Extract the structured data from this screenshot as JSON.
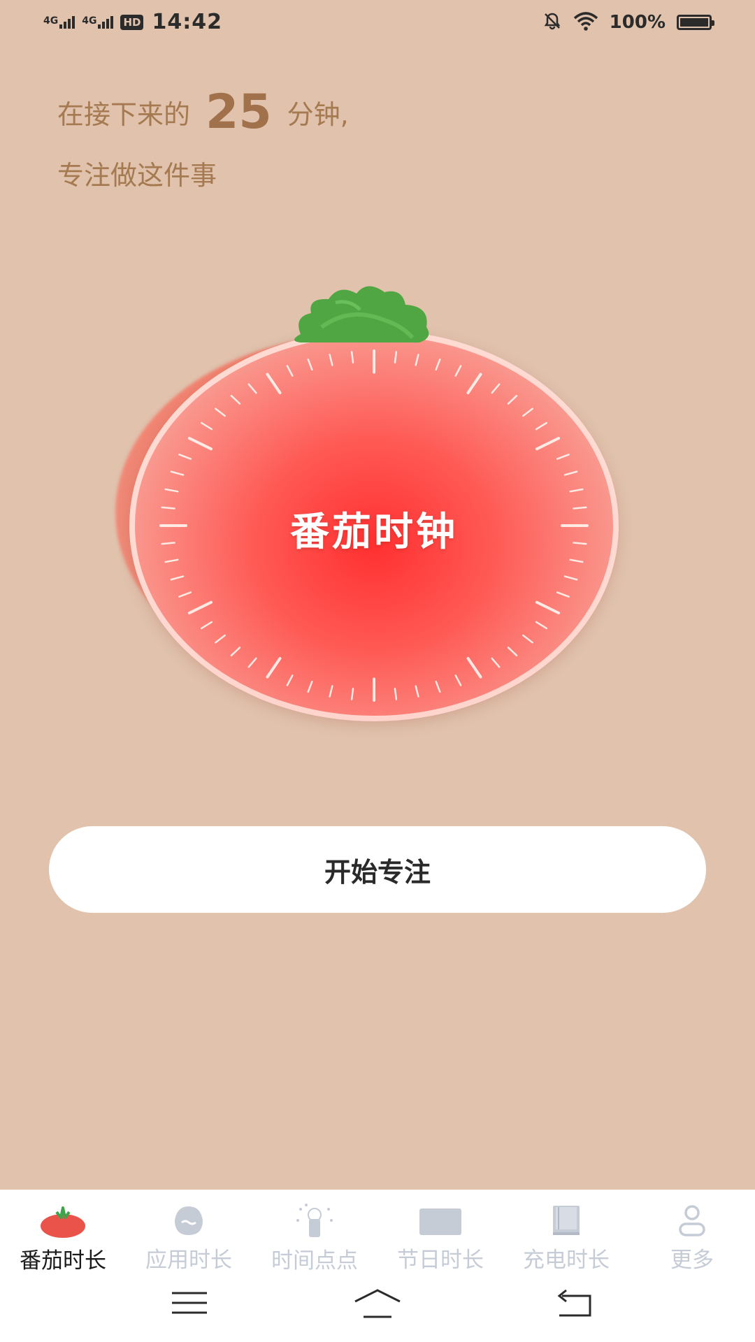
{
  "status_bar": {
    "network1": "4G",
    "network2": "4G",
    "hd": "HD",
    "time": "14:42",
    "battery": "100%"
  },
  "headline": {
    "prefix": "在接下来的",
    "minutes": "25",
    "suffix": "分钟,",
    "line2": "专注做这件事"
  },
  "tomato": {
    "title": "番茄时钟"
  },
  "start_button": {
    "label": "开始专注"
  },
  "bottom_nav": {
    "items": [
      {
        "label": "番茄时长",
        "icon": "tomato-icon",
        "active": true
      },
      {
        "label": "应用时长",
        "icon": "app-time-icon",
        "active": false
      },
      {
        "label": "时间点点",
        "icon": "time-dots-icon",
        "active": false
      },
      {
        "label": "节日时长",
        "icon": "calendar-icon",
        "active": false
      },
      {
        "label": "充电时长",
        "icon": "book-icon",
        "active": false
      },
      {
        "label": "更多",
        "icon": "user-icon",
        "active": false
      }
    ]
  },
  "colors": {
    "background": "#e0c2ad",
    "headline": "#a67a51",
    "tomato": "#ff3030",
    "leaf": "#4fa642",
    "nav_inactive": "#c6ccd6"
  }
}
